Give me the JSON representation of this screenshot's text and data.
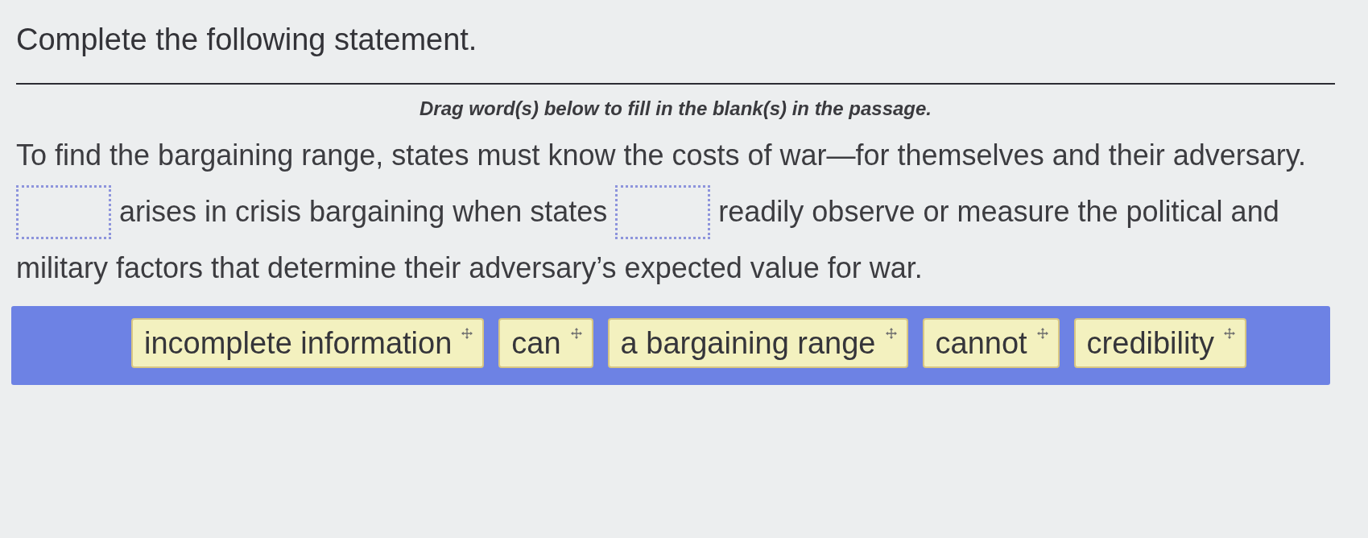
{
  "question": {
    "heading": "Complete the following statement.",
    "instructions": "Drag word(s) below to fill in the blank(s) in the passage."
  },
  "passage": {
    "lines": [
      [
        {
          "kind": "text",
          "text": "To find the bargaining range, states must know the costs of war—for themselves and their adversary."
        }
      ],
      [
        {
          "kind": "blank"
        },
        {
          "kind": "text",
          "text": "arises in crisis bargaining when states"
        },
        {
          "kind": "blank"
        },
        {
          "kind": "text",
          "text": "readily observe or measure the political and"
        }
      ],
      [
        {
          "kind": "text",
          "text": "military factors that determine their adversary’s expected value for war."
        }
      ]
    ]
  },
  "word_bank": {
    "tiles": [
      {
        "label": "incomplete information"
      },
      {
        "label": "can"
      },
      {
        "label": "a bargaining range"
      },
      {
        "label": "cannot"
      },
      {
        "label": "credibility"
      }
    ]
  }
}
